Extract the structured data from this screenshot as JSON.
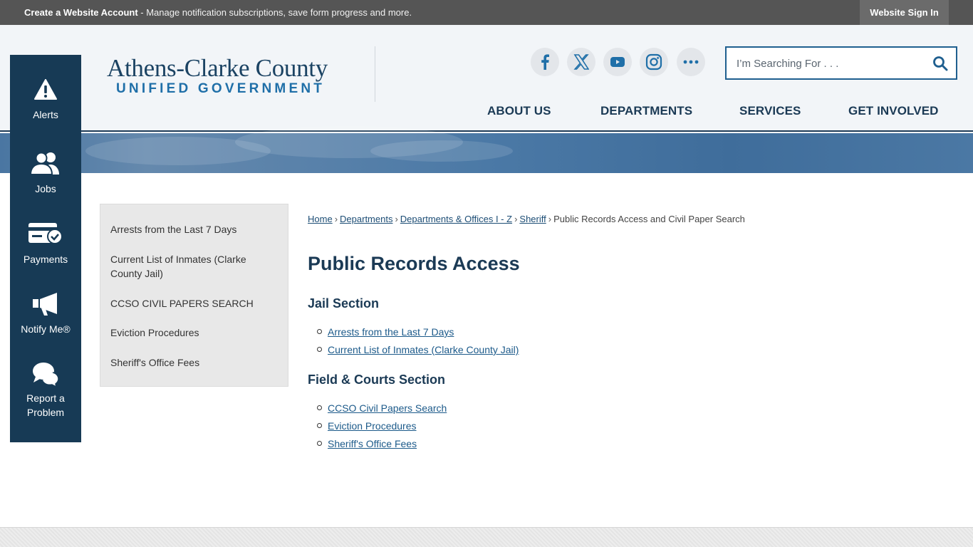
{
  "topbar": {
    "create_account": "Create a Website Account",
    "message": " - Manage notification subscriptions, save form progress and more.",
    "sign_in": "Website Sign In"
  },
  "logo": {
    "line1": "Athens-Clarke County",
    "line2": "UNIFIED GOVERNMENT"
  },
  "social": [
    "facebook-icon",
    "x-icon",
    "youtube-icon",
    "instagram-icon",
    "more-icon"
  ],
  "search": {
    "placeholder": "I’m Searching For . . ."
  },
  "nav": [
    "ABOUT US",
    "DEPARTMENTS",
    "SERVICES",
    "GET INVOLVED"
  ],
  "quick_links": [
    {
      "label": "Alerts",
      "icon": "alert-icon"
    },
    {
      "label": "Jobs",
      "icon": "people-icon"
    },
    {
      "label": "Payments",
      "icon": "payment-card-icon"
    },
    {
      "label": "Notify Me®",
      "icon": "megaphone-icon"
    },
    {
      "label": "Report a Problem",
      "icon": "chat-bubbles-icon"
    }
  ],
  "side_menu": [
    "Arrests from the Last 7 Days",
    "Current List of Inmates (Clarke County Jail)",
    "CCSO CIVIL PAPERS SEARCH",
    "Eviction Procedures",
    "Sheriff's Office Fees"
  ],
  "breadcrumb": {
    "links": [
      "Home",
      "Departments",
      "Departments & Offices I - Z",
      "Sheriff"
    ],
    "current": "Public Records Access and Civil Paper Search"
  },
  "page_title": "Public Records Access",
  "sections": [
    {
      "heading": "Jail Section",
      "links": [
        "Arrests from the Last 7 Days",
        "Current List of Inmates (Clarke County Jail)"
      ]
    },
    {
      "heading": "Field & Courts Section",
      "links": [
        "CCSO Civil Papers Search",
        "Eviction Procedures",
        "Sheriff's Office Fees"
      ]
    }
  ],
  "colors": {
    "navy": "#173a55",
    "link": "#1c5a8a",
    "banner": "#4b79a6"
  }
}
